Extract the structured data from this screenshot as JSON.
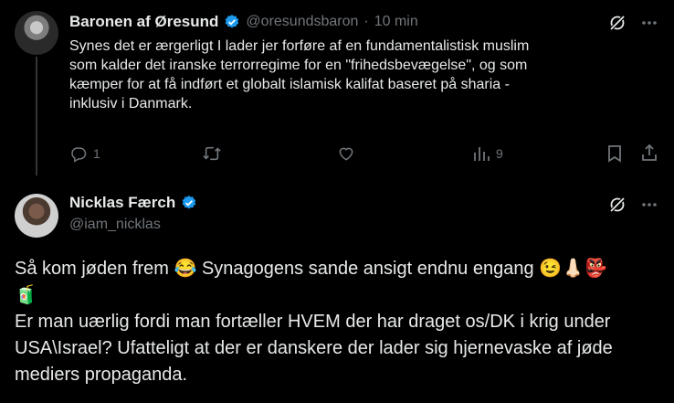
{
  "tweet1": {
    "display_name": "Baronen af Øresund",
    "handle": "@oresundsbaron",
    "separator": "·",
    "time": "10 min",
    "text_lines": [
      "Synes det er ærgerligt I lader jer forføre af en fundamentalistisk muslim",
      "som kalder det iranske terrorregime for en \"frihedsbevægelse\", og som",
      "kæmper for at få indført et globalt islamisk kalifat baseret på sharia -",
      "inklusiv i Danmark."
    ],
    "reply_count": "1",
    "views_count": "9",
    "icons": [
      "grok-icon",
      "more-icon",
      "reply-icon",
      "retweet-icon",
      "like-icon",
      "views-icon",
      "bookmark-icon",
      "share-icon",
      "verified-badge-icon"
    ]
  },
  "tweet2": {
    "display_name": "Nicklas Færch",
    "handle": "@iam_nicklas",
    "line1": "Så kom jøden frem 😂 Synagogens sande ansigt endnu engang 😉👃🏻👺",
    "line1_cont": "🧃",
    "line2": "Er man uærlig fordi man fortæller HVEM der har draget os/DK i krig under",
    "line3": "USA\\Israel? Ufatteligt at der er danskere der lader sig hjernevaske af jøde",
    "line4": "mediers propaganda.",
    "icons": [
      "grok-icon",
      "more-icon",
      "verified-badge-icon"
    ]
  },
  "colors": {
    "background": "#000000",
    "text": "#e7e9ea",
    "muted": "#71767b",
    "verified": "#1d9bf0",
    "divider": "#333639"
  }
}
